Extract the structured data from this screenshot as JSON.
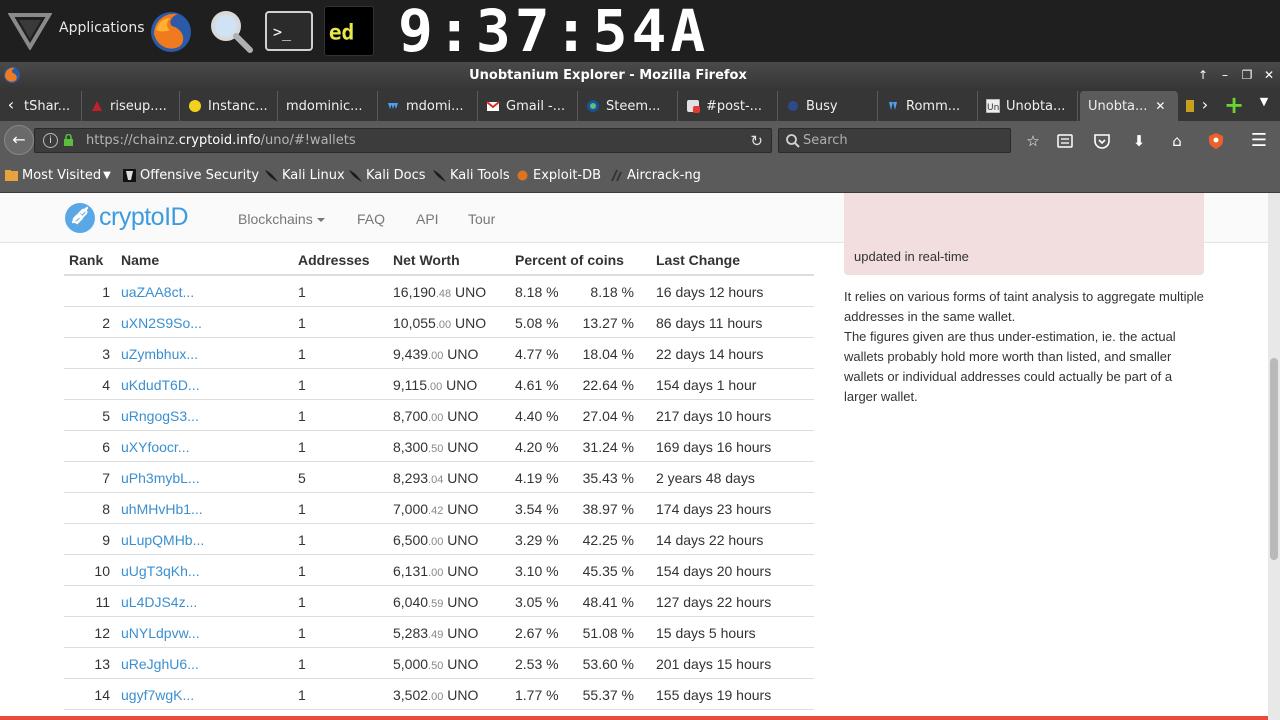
{
  "panel": {
    "applications_label": "Applications",
    "clock": "9:37:54A"
  },
  "window": {
    "title": "Unobtanium Explorer - Mozilla Firefox"
  },
  "tabs": [
    {
      "label": "tShar..."
    },
    {
      "label": "riseup...."
    },
    {
      "label": "Instanc..."
    },
    {
      "label": "mdominic..."
    },
    {
      "label": "mdomi..."
    },
    {
      "label": "Gmail -..."
    },
    {
      "label": "Steem..."
    },
    {
      "label": "#post-..."
    },
    {
      "label": "Busy"
    },
    {
      "label": "Romm..."
    },
    {
      "label": "Unobta..."
    },
    {
      "label": "Unobta..."
    }
  ],
  "navbar": {
    "url_prefix": "https://chainz.",
    "url_host": "cryptoid.info",
    "url_suffix": "/uno/#!wallets",
    "search_placeholder": "Search"
  },
  "bookmarks": [
    {
      "label": "Most Visited"
    },
    {
      "label": "Offensive Security"
    },
    {
      "label": "Kali Linux"
    },
    {
      "label": "Kali Docs"
    },
    {
      "label": "Kali Tools"
    },
    {
      "label": "Exploit-DB"
    },
    {
      "label": "Aircrack-ng"
    }
  ],
  "site": {
    "brand": "cryptoID",
    "nav": {
      "blockchains": "Blockchains",
      "faq": "FAQ",
      "api": "API",
      "tour": "Tour"
    }
  },
  "table": {
    "headers": {
      "rank": "Rank",
      "name": "Name",
      "addresses": "Addresses",
      "net_worth": "Net Worth",
      "percent": "Percent of coins",
      "last_change": "Last Change"
    },
    "rows": [
      {
        "rank": "1",
        "name": "uaZAA8ct...",
        "addresses": "1",
        "worth_int": "16,190",
        "worth_dec": ".48",
        "unit": " UNO",
        "pct": "8.18 %",
        "cum": "8.18 %",
        "last": "16 days 12 hours"
      },
      {
        "rank": "2",
        "name": "uXN2S9So...",
        "addresses": "1",
        "worth_int": "10,055",
        "worth_dec": ".00",
        "unit": " UNO",
        "pct": "5.08 %",
        "cum": "13.27 %",
        "last": "86 days 11 hours"
      },
      {
        "rank": "3",
        "name": "uZymbhux...",
        "addresses": "1",
        "worth_int": "9,439",
        "worth_dec": ".00",
        "unit": " UNO",
        "pct": "4.77 %",
        "cum": "18.04 %",
        "last": "22 days 14 hours"
      },
      {
        "rank": "4",
        "name": "uKdudT6D...",
        "addresses": "1",
        "worth_int": "9,115",
        "worth_dec": ".00",
        "unit": " UNO",
        "pct": "4.61 %",
        "cum": "22.64 %",
        "last": "154 days 1 hour"
      },
      {
        "rank": "5",
        "name": "uRngogS3...",
        "addresses": "1",
        "worth_int": "8,700",
        "worth_dec": ".00",
        "unit": " UNO",
        "pct": "4.40 %",
        "cum": "27.04 %",
        "last": "217 days 10 hours"
      },
      {
        "rank": "6",
        "name": "uXYfoocr...",
        "addresses": "1",
        "worth_int": "8,300",
        "worth_dec": ".50",
        "unit": " UNO",
        "pct": "4.20 %",
        "cum": "31.24 %",
        "last": "169 days 16 hours"
      },
      {
        "rank": "7",
        "name": "uPh3mybL...",
        "addresses": "5",
        "worth_int": "8,293",
        "worth_dec": ".04",
        "unit": " UNO",
        "pct": "4.19 %",
        "cum": "35.43 %",
        "last": "2 years 48 days"
      },
      {
        "rank": "8",
        "name": "uhMHvHb1...",
        "addresses": "1",
        "worth_int": "7,000",
        "worth_dec": ".42",
        "unit": " UNO",
        "pct": "3.54 %",
        "cum": "38.97 %",
        "last": "174 days 23 hours"
      },
      {
        "rank": "9",
        "name": "uLupQMHb...",
        "addresses": "1",
        "worth_int": "6,500",
        "worth_dec": ".00",
        "unit": " UNO",
        "pct": "3.29 %",
        "cum": "42.25 %",
        "last": "14 days 22 hours"
      },
      {
        "rank": "10",
        "name": "uUgT3qKh...",
        "addresses": "1",
        "worth_int": "6,131",
        "worth_dec": ".00",
        "unit": " UNO",
        "pct": "3.10 %",
        "cum": "45.35 %",
        "last": "154 days 20 hours"
      },
      {
        "rank": "11",
        "name": "uL4DJS4z...",
        "addresses": "1",
        "worth_int": "6,040",
        "worth_dec": ".59",
        "unit": " UNO",
        "pct": "3.05 %",
        "cum": "48.41 %",
        "last": "127 days 22 hours"
      },
      {
        "rank": "12",
        "name": "uNYLdpvw...",
        "addresses": "1",
        "worth_int": "5,283",
        "worth_dec": ".49",
        "unit": " UNO",
        "pct": "2.67 %",
        "cum": "51.08 %",
        "last": "15 days 5 hours"
      },
      {
        "rank": "13",
        "name": "uReJghU6...",
        "addresses": "1",
        "worth_int": "5,000",
        "worth_dec": ".50",
        "unit": " UNO",
        "pct": "2.53 %",
        "cum": "53.60 %",
        "last": "201 days 15 hours"
      },
      {
        "rank": "14",
        "name": "ugyf7wgK...",
        "addresses": "1",
        "worth_int": "3,502",
        "worth_dec": ".00",
        "unit": " UNO",
        "pct": "1.77 %",
        "cum": "55.37 %",
        "last": "155 days 19 hours"
      }
    ]
  },
  "sidebar": {
    "alert_text": "updated in real-time",
    "paragraph1": "It relies on various forms of taint analysis to aggregate multiple addresses in the same wallet.",
    "paragraph2": "The figures given are thus under-estimation, ie. the actual wallets probably hold more worth than listed, and smaller wallets or individual addresses could actually be part of a larger wallet."
  },
  "colors": {
    "link": "#3a8fd0",
    "brand": "#3d9be0",
    "alert_bg": "#f2dede",
    "accent_bottom": "#e74c3c"
  }
}
